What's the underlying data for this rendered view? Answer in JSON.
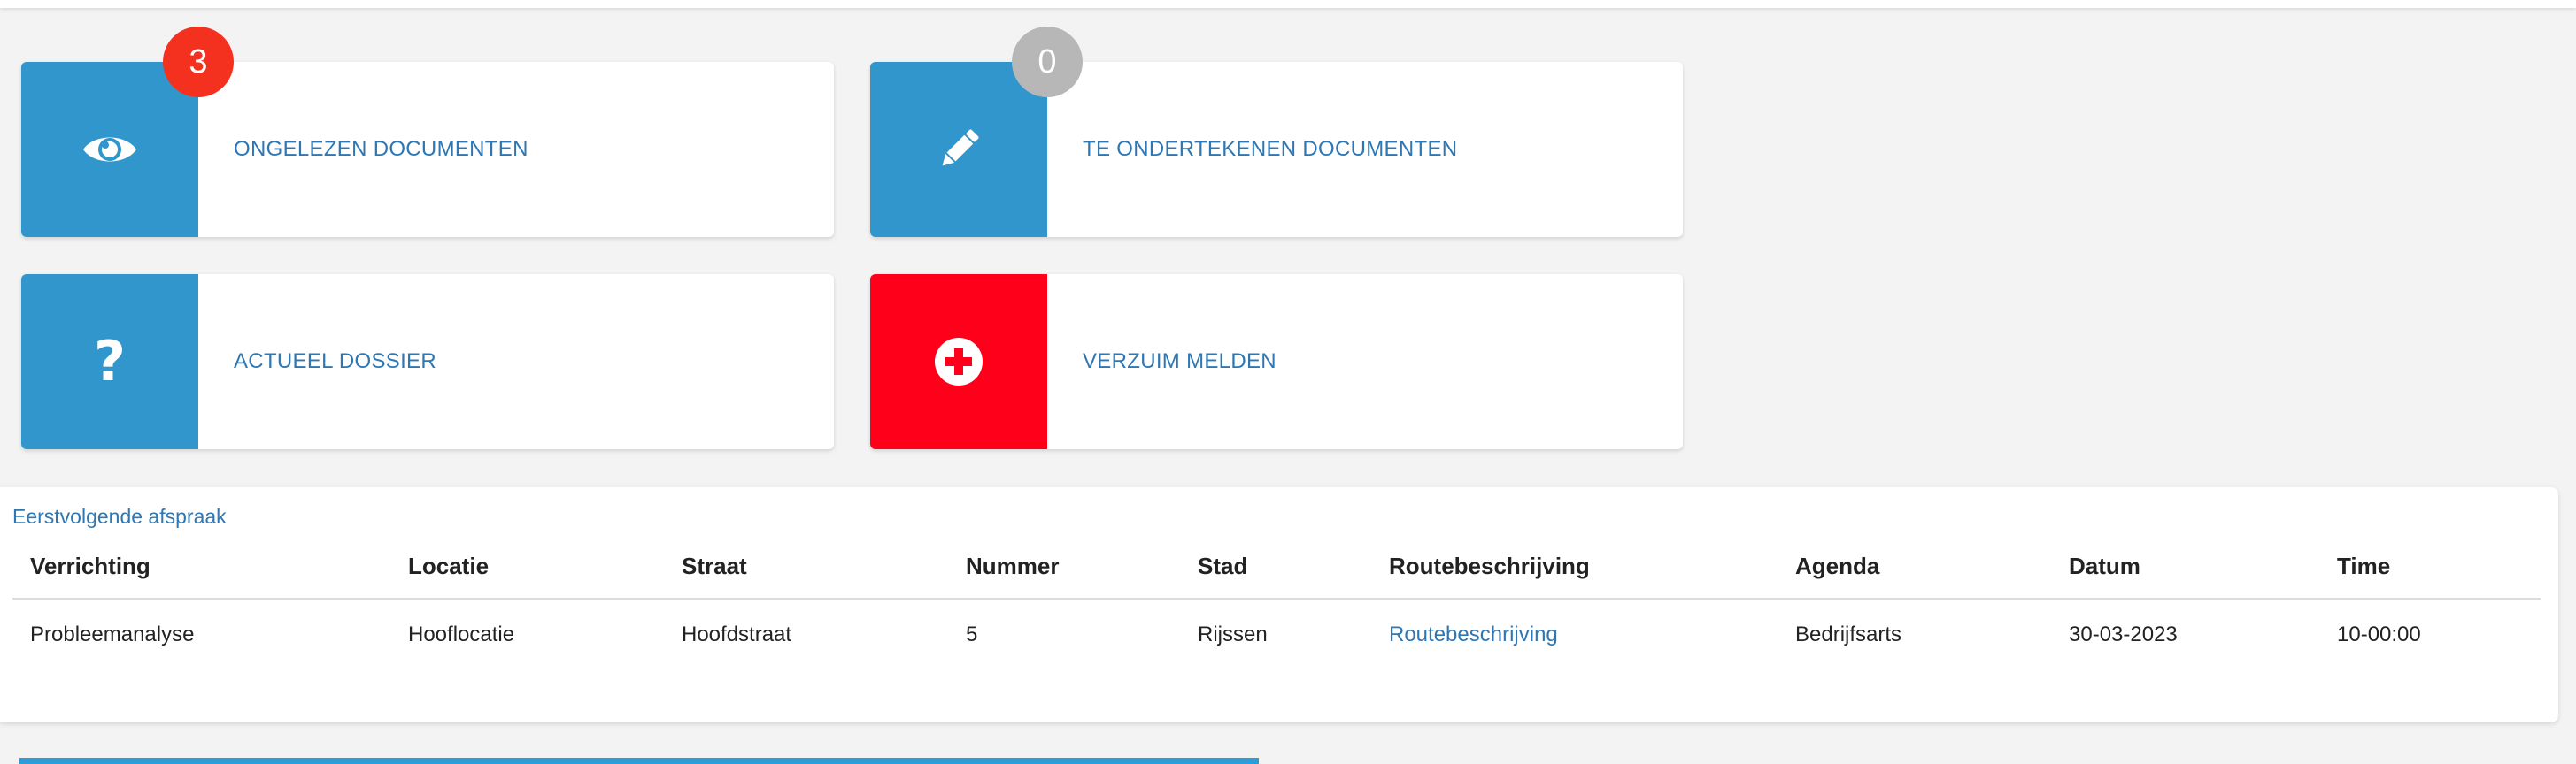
{
  "tiles": {
    "unread": {
      "label": "ONGELEZEN DOCUMENTEN",
      "badge": "3",
      "icon": "eye-icon",
      "icon_color": "#3196cb",
      "badge_color": "#f4311e"
    },
    "sign": {
      "label": "TE ONDERTEKENEN DOCUMENTEN",
      "badge": "0",
      "icon": "pencil-icon",
      "icon_color": "#3196cb",
      "badge_color": "#b7b7b7"
    },
    "dossier": {
      "label": "ACTUEEL DOSSIER",
      "icon": "question-icon",
      "icon_color": "#3196cb"
    },
    "absence": {
      "label": "VERZUIM MELDEN",
      "icon": "plus-circle-icon",
      "icon_color": "#ff001a"
    }
  },
  "appointment": {
    "title": "Eerstvolgende afspraak",
    "columns": [
      "Verrichting",
      "Locatie",
      "Straat",
      "Nummer",
      "Stad",
      "Routebeschrijving",
      "Agenda",
      "Datum",
      "Time"
    ],
    "rows": [
      [
        "Probleemanalyse",
        "Hooflocatie",
        "Hoofdstraat",
        "5",
        "Rijssen",
        "Routebeschrijving",
        "Bedrijfsarts",
        "30-03-2023",
        "10-00:00"
      ]
    ]
  },
  "colors": {
    "accent": "#2f77b3",
    "tile_blue": "#3196cb",
    "alert_red": "#ff001a"
  }
}
